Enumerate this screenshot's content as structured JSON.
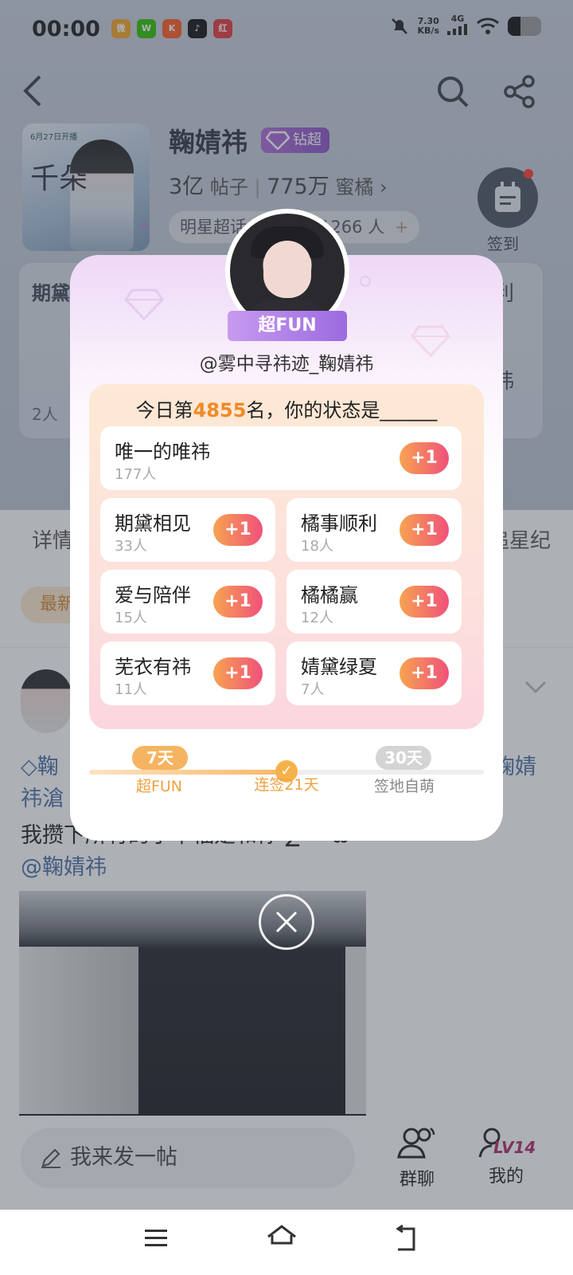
{
  "status_bar": {
    "time": "00:00",
    "net_speed": "7.30",
    "net_unit": "KB/s",
    "net_type": "4G"
  },
  "header": {
    "title": "鞠婧祎",
    "badge": "钻超",
    "posts_count": "3亿",
    "posts_label": "帖子",
    "members_count": "775万",
    "members_label": "蜜橘",
    "pill_rank": "明星超话",
    "pill_checkin": "签到 1266 人",
    "checkin_label": "签到",
    "cover_text": "6月27日开播",
    "cover_char": "千朵"
  },
  "background": {
    "card_left_title": "期黛",
    "card_right_title": "利",
    "card_right_title2": "祎",
    "count_left": "2人",
    "tab_left": "详情",
    "tab_right": "追星纪",
    "chip_left": "最新",
    "post_text_1a": "鞠",
    "post_text_1b": "鞠婧",
    "post_text_2": "祎滄",
    "post_text_3": "我攒下所有的小幸福是和你 ∑ = ω =",
    "post_mention": "@鞠婧祎"
  },
  "modal": {
    "fan_badge": "超FUN",
    "username": "@雾中寻祎迹_鞠婧祎",
    "question_prefix": "今日第",
    "rank": "4855",
    "question_suffix": "名，你的状态是______",
    "plus_label": "+1",
    "options": [
      {
        "name": "唯一的唯祎",
        "count": "177人"
      },
      {
        "name": "期黛相见",
        "count": "33人"
      },
      {
        "name": "橘事顺利",
        "count": "18人"
      },
      {
        "name": "爱与陪伴",
        "count": "15人"
      },
      {
        "name": "橘橘赢",
        "count": "12人"
      },
      {
        "name": "芜衣有祎",
        "count": "11人"
      },
      {
        "name": "婧黛绿夏",
        "count": "7人"
      }
    ],
    "milestones": [
      {
        "pill": "7天",
        "label": "超FUN"
      },
      {
        "pill": "",
        "label": "连签21天"
      },
      {
        "pill": "30天",
        "label": "签地自萌"
      }
    ],
    "progress_fraction": 0.5
  },
  "bottom": {
    "write_placeholder": "我来发一帖",
    "group_chat": "群聊",
    "mine": "我的",
    "level": "LV14"
  },
  "colors": {
    "accent_orange": "#f08a25",
    "plus_gradient_start": "#f7a351",
    "plus_gradient_end": "#f0517a",
    "badge_purple": "#9b6be0"
  }
}
